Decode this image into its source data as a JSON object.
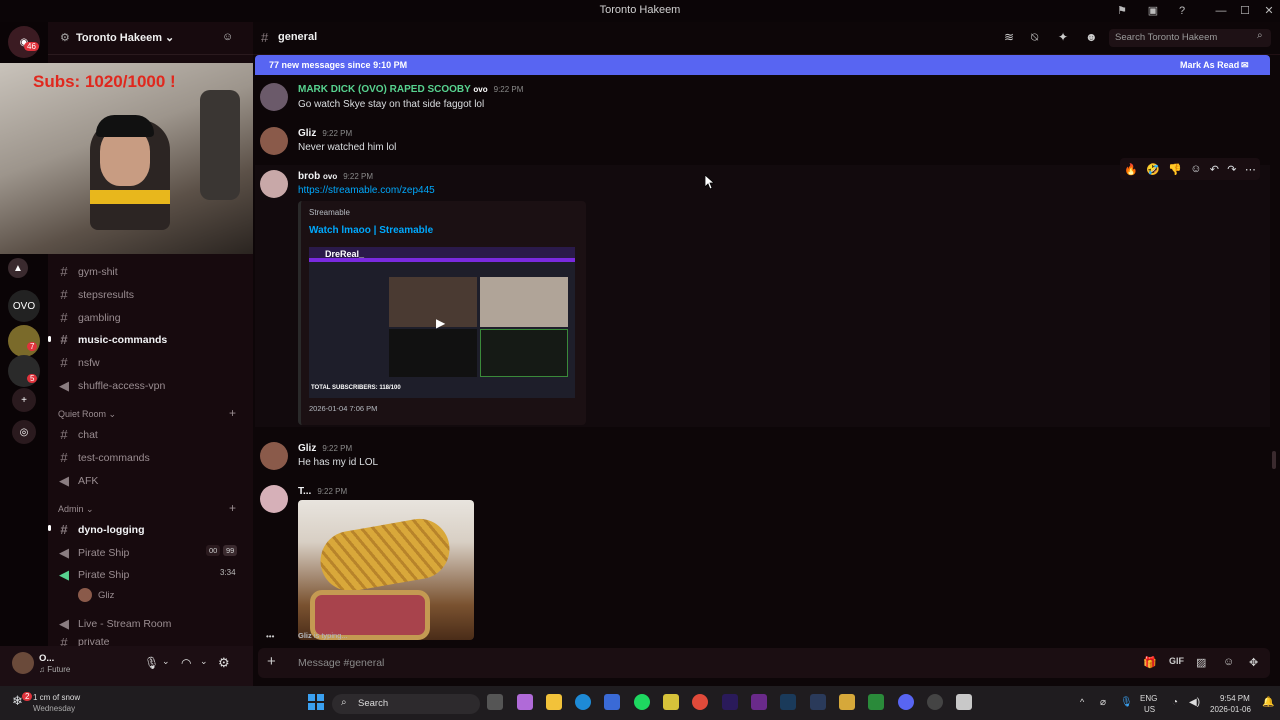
{
  "window": {
    "title": "Toronto Hakeem",
    "minimize": "—",
    "maximize": "☐",
    "close": "✕"
  },
  "rail": {
    "badge_top": "46",
    "badge_a": "7",
    "badge_b": "5"
  },
  "server": {
    "name": "Toronto Hakeem ⌄"
  },
  "stream": {
    "overlay_text": "Subs: 1020/1000  !"
  },
  "channels": [
    {
      "label": "gym-shit",
      "icon": "hash",
      "bright": false
    },
    {
      "label": "stepsresults",
      "icon": "hash",
      "bright": false
    },
    {
      "label": "gambling",
      "icon": "hash",
      "bright": false
    },
    {
      "label": "music-commands",
      "icon": "hash",
      "bright": true
    },
    {
      "label": "nsfw",
      "icon": "hash",
      "bright": false
    },
    {
      "label": "shuffle-access-vpn",
      "icon": "speaker",
      "bright": false
    }
  ],
  "categories": {
    "quiet_room": "Quiet Room ⌄",
    "admin": "Admin ⌄"
  },
  "quiet_channels": [
    {
      "label": "chat",
      "icon": "hash"
    },
    {
      "label": "test-commands",
      "icon": "hash"
    },
    {
      "label": "AFK",
      "icon": "speaker"
    }
  ],
  "admin_channels": {
    "dyno": "dyno-logging",
    "pirate1": "Pirate Ship",
    "pirate1_a": "00",
    "pirate1_b": "99",
    "pirate2": "Pirate Ship",
    "pirate2_time": "3:34",
    "voice_user": "Gliz",
    "live": "Live - Stream Room",
    "partial": "private"
  },
  "userpanel": {
    "name": "O...",
    "status": "♫ Future"
  },
  "topbar": {
    "channel": "general",
    "search_placeholder": "Search Toronto Hakeem"
  },
  "newbar": {
    "text": "77 new messages since 9:10 PM",
    "action": "Mark As Read"
  },
  "messages": {
    "m1": {
      "author": "MARK DICK (OVO) RAPED SCOOBY",
      "tag": "ovo",
      "time": "9:22 PM",
      "text": "Go watch Skye stay on that side faggot lol"
    },
    "m2": {
      "author": "Gliz",
      "time": "9:22 PM",
      "text": "Never watched him lol"
    },
    "m3": {
      "author": "brob",
      "tag": "ovo",
      "time": "9:22 PM",
      "link": "https://streamable.com/zep445"
    },
    "m4": {
      "author": "Gliz",
      "time": "9:22 PM",
      "text": "He has my id LOL"
    },
    "m5": {
      "author": "T...",
      "time": "9:22 PM"
    }
  },
  "embed": {
    "provider": "Streamable",
    "title": "Watch lmaoo | Streamable",
    "date": "2026-01-04 7:06 PM",
    "inner_name": "DreReal_",
    "inner_subs": "TOTAL SUBSCRIBERS: 118/100"
  },
  "typing": {
    "user": "Gliz",
    "suffix": " is typing..."
  },
  "composer": {
    "placeholder": "Message #general"
  },
  "taskbar": {
    "weather": "1 cm of snow",
    "weather_day": "Wednesday",
    "search": "Search",
    "lang_top": "ENG",
    "lang_bottom": "US",
    "time": "9:54 PM",
    "date": "2026-01-06"
  },
  "colors": {
    "accent": "#5865f2",
    "link": "#00a8fc",
    "author_green": "#57d28f",
    "alert_red": "#e0333c"
  }
}
